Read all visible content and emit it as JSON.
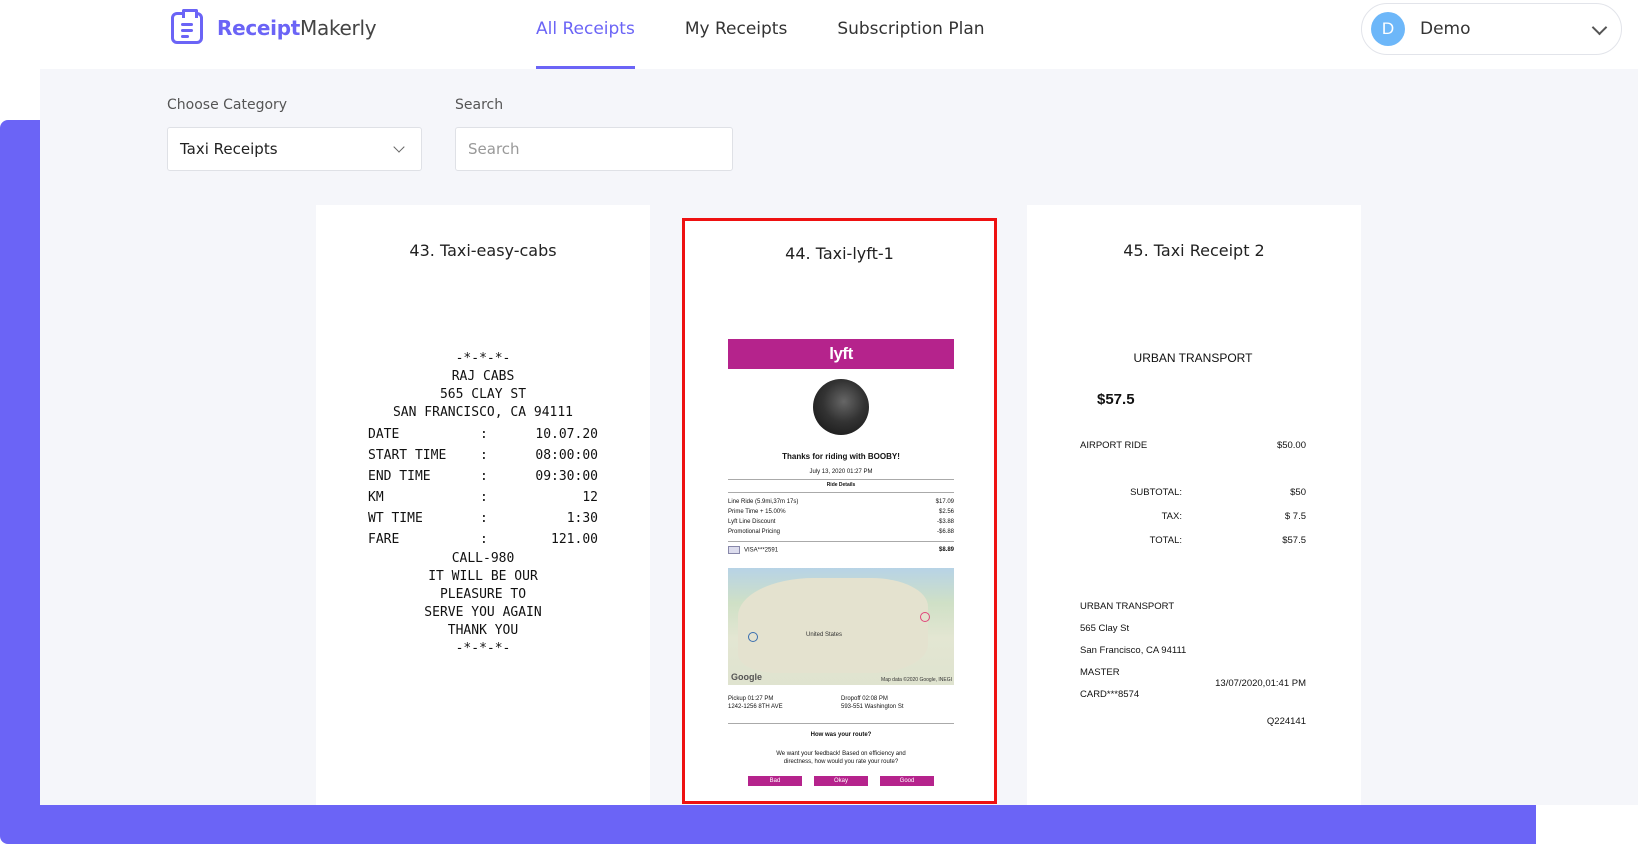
{
  "header": {
    "logo_bold": "Receipt",
    "logo_rest": "Makerly",
    "nav": [
      "All Receipts",
      "My Receipts",
      "Subscription Plan"
    ],
    "user_initial": "D",
    "user_name": "Demo"
  },
  "filters": {
    "category_label": "Choose Category",
    "category_value": "Taxi Receipts",
    "search_label": "Search",
    "search_placeholder": "Search"
  },
  "cards": [
    {
      "title": "43. Taxi-easy-cabs"
    },
    {
      "title": "44. Taxi-lyft-1"
    },
    {
      "title": "45. Taxi Receipt 2"
    }
  ],
  "receipt1": {
    "stars": "-*-*-*-",
    "name": "RAJ CABS",
    "street": "565 CLAY ST",
    "city": "SAN FRANCISCO, CA 94111",
    "rows": [
      {
        "k": "DATE",
        "v": "10.07.20"
      },
      {
        "k": "START TIME",
        "v": "08:00:00"
      },
      {
        "k": "END TIME",
        "v": "09:30:00"
      },
      {
        "k": "KM",
        "v": "12"
      },
      {
        "k": "WT TIME",
        "v": "1:30"
      },
      {
        "k": "FARE",
        "v": "121.00"
      }
    ],
    "sep": ":",
    "call": "CALL-980",
    "l1": "IT WILL BE OUR",
    "l2": "PLEASURE TO",
    "l3": "SERVE YOU AGAIN",
    "l4": "THANK YOU",
    "stars_end": "-*-*-*-"
  },
  "receipt2": {
    "logo": "lyft",
    "thanks": "Thanks for riding with BOOBY!",
    "date": "July 13, 2020 01:27 PM",
    "ride_details": "Ride Details",
    "lines": [
      {
        "k": "Line Ride (5.9mi,37m 17s)",
        "v": "$17.09"
      },
      {
        "k": "Prime Time + 15.00%",
        "v": "$2.56"
      },
      {
        "k": "Lyft Line Discount",
        "v": "-$3.88"
      },
      {
        "k": "Promotional Pricing",
        "v": "-$6.88"
      }
    ],
    "visa": "VISA***2591",
    "visa_amt": "$8.89",
    "map_country": "United States",
    "map_credit": "Map data ©2020 Google, INEGI",
    "map_logo": "Google",
    "pickup": "Pickup 01:27 PM",
    "pickup_addr": "1242-1256 8TH AVE",
    "dropoff": "Dropoff 02:08 PM",
    "dropoff_addr": "593-551 Washington St",
    "question": "How was your route?",
    "feedback1": "We want your feedback! Based on efficiency and",
    "feedback2": "directness, how would you rate your route?",
    "btn_bad": "Bad",
    "btn_okay": "Okay",
    "btn_good": "Good"
  },
  "receipt3": {
    "company": "URBAN TRANSPORT",
    "total_big": "$57.5",
    "ride_label": "AIRPORT RIDE",
    "ride_amt": "$50.00",
    "subtotal_label": "SUBTOTAL:",
    "subtotal": "$50",
    "tax_label": "TAX:",
    "tax": "$ 7.5",
    "total_label": "TOTAL:",
    "total": "$57.5",
    "addr_name": "URBAN TRANSPORT",
    "addr_street": "565 Clay St",
    "addr_city": "San Francisco, CA 94111",
    "card1": "MASTER",
    "card2": "CARD***8574",
    "datetime": "13/07/2020,01:41 PM",
    "code": "Q224141"
  }
}
